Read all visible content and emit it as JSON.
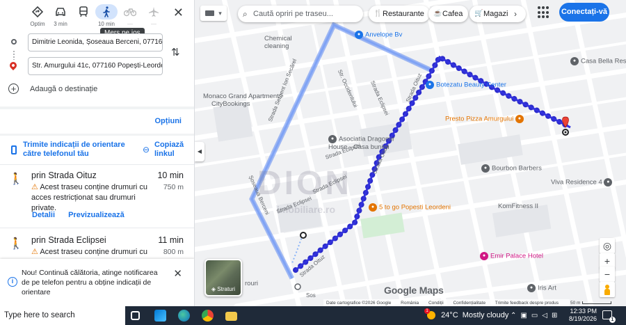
{
  "modes": [
    {
      "label": "Optim",
      "icon": "best-route-icon"
    },
    {
      "label": "3 min",
      "icon": "car-icon"
    },
    {
      "label": "",
      "icon": "transit-icon"
    },
    {
      "label": "10 min",
      "icon": "walk-icon"
    },
    {
      "label": "—",
      "icon": "bicycle-icon"
    },
    {
      "label": "—",
      "icon": "flight-icon"
    }
  ],
  "tooltip": "Mers pe jos",
  "origin": "Dimitrie Leonida, Șoseaua Berceni, 077160",
  "destination": "Str. Amurgului 41c, 077160 Popești-Leordeni",
  "add_destination": "Adaugă o destinație",
  "options_label": "Opțiuni",
  "send_directions": "Trimite indicații de orientare către telefonul tău",
  "copy_link": "Copiază linkul",
  "routes": [
    {
      "name": "prin Strada Oituz",
      "time": "10 min",
      "distance": "750 m",
      "warning": "Acest traseu conține drumuri cu acces restricționat sau drumuri private.",
      "details": "Detalii",
      "preview": "Previzualizează"
    },
    {
      "name": "prin Strada Eclipsei",
      "time": "11 min",
      "distance": "800 m",
      "warning": "Acest traseu conține drumuri cu"
    }
  ],
  "notice": "Nou! Continuă călătoria, atinge notificarea de pe telefon pentru a obține indicații de orientare",
  "map": {
    "search_placeholder": "Caută opriri pe traseu...",
    "chips": [
      {
        "label": "Restaurante",
        "icon": "fork-knife-icon"
      },
      {
        "label": "Cafea",
        "icon": "coffee-icon"
      },
      {
        "label": "Magazi",
        "icon": "shopping-cart-icon"
      }
    ],
    "signin": "Conectați-vă",
    "layers_label": "Straturi",
    "logo": "Google Maps",
    "attribution": [
      "Date cartografice ©2026 Google",
      "România",
      "Condiții",
      "Confidențialitate",
      "Trimite feedback despre produs"
    ],
    "scale": "50 m",
    "pois": [
      {
        "name": "Chemical cleaning",
        "color": "#5f6368"
      },
      {
        "name": "Anvelope Bv",
        "color": "#1a73e8"
      },
      {
        "name": "Botezatu Beauty Center",
        "color": "#1a73e8"
      },
      {
        "name": "Presto Pizza Amurgului",
        "color": "#e37400"
      },
      {
        "name": "Casa Bella Residence",
        "color": "#5f6368"
      },
      {
        "name": "Monaco Grand Apartments",
        "color": "#5f6368"
      },
      {
        "name": "CityBookings",
        "color": "#5f6368"
      },
      {
        "name": "Asociatia Dragomir House - Casa bunicii",
        "color": "#5f6368"
      },
      {
        "name": "Bourbon Barbers",
        "color": "#5f6368"
      },
      {
        "name": "Viva Residence 4",
        "color": "#5f6368"
      },
      {
        "name": "KomFitness II",
        "color": "#5f6368"
      },
      {
        "name": "5 to go Popesti Leordeni",
        "color": "#e37400"
      },
      {
        "name": "Emir Palace Hotel",
        "color": "#d01884"
      },
      {
        "name": "Iris Art",
        "color": "#5f6368"
      },
      {
        "name": "rouri",
        "color": "#5f6368"
      }
    ],
    "streets": [
      "Str. Occidentului",
      "Strada Eclipsei",
      "Strada Oituz",
      "Strada Sergent Ion Secărel",
      "Șoseaua Berceni",
      "Strada Eclipsei",
      "Strada Eclipsei",
      "Strada Oituz",
      "Strada Eclipsei",
      "Strada Oituz",
      "Sos"
    ],
    "watermark": "DION",
    "watermark_sub": "imobiliare.ro"
  },
  "taskbar": {
    "search": "Type here to search",
    "temperature": "24°C",
    "weather": "Mostly cloudy",
    "time": "12:33 PM",
    "date": "8/19/2026",
    "notifications": "1",
    "weather_badge": "1"
  }
}
